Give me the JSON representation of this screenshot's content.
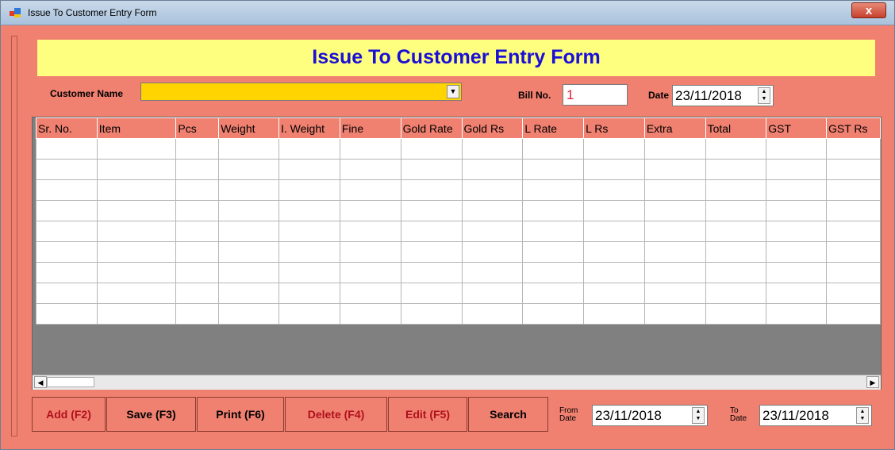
{
  "window": {
    "title": "Issue To Customer Entry Form",
    "close_glyph": "x"
  },
  "banner": {
    "title": "Issue To Customer Entry Form"
  },
  "customer": {
    "label": "Customer Name",
    "value": ""
  },
  "bill": {
    "label": "Bill No.",
    "value": "1"
  },
  "date": {
    "label": "Date",
    "value": "23/11/2018"
  },
  "grid": {
    "columns": [
      "Sr. No.",
      "Item",
      "Pcs",
      "Weight",
      "I. Weight",
      "Fine",
      "Gold Rate",
      "Gold Rs",
      "L Rate",
      "L Rs",
      "Extra",
      "Total",
      "GST",
      "GST Rs"
    ],
    "empty_rows": 9
  },
  "buttons": {
    "add": "Add (F2)",
    "save": "Save (F3)",
    "print": "Print (F6)",
    "delete": "Delete (F4)",
    "edit": "Edit (F5)",
    "search": "Search"
  },
  "range": {
    "from_label": "From Date",
    "from_value": "23/11/2018",
    "to_label": "To Date",
    "to_value": "23/11/2018"
  },
  "colors": {
    "form_bg": "#f08070",
    "banner_bg": "#ffff7f",
    "banner_text": "#1a0fd6",
    "combo_bg": "#ffd400"
  }
}
